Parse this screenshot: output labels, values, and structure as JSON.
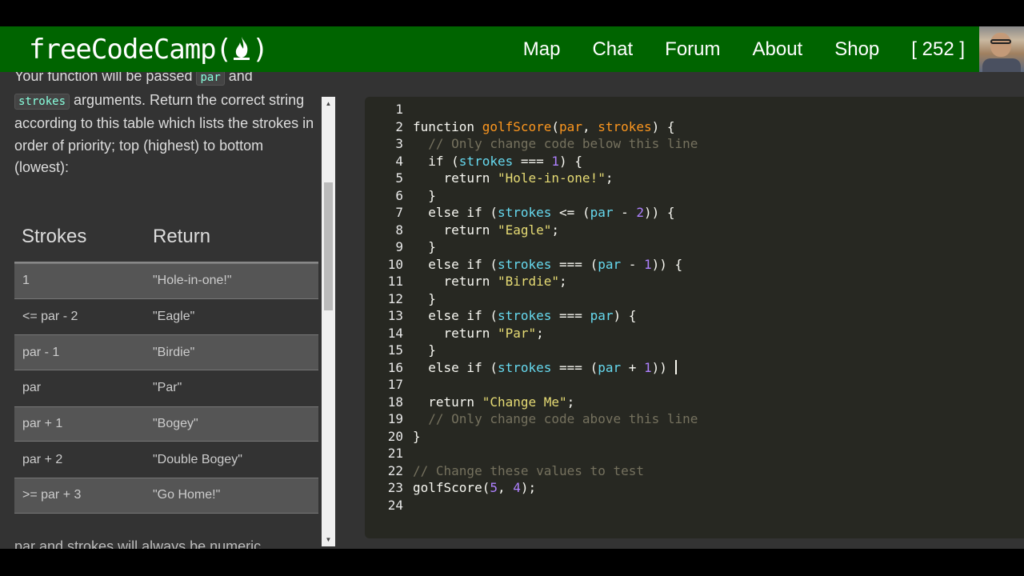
{
  "brand": {
    "text": "freeCodeCamp",
    "open": "(",
    "close": ")"
  },
  "nav": {
    "links": [
      {
        "label": "Map"
      },
      {
        "label": "Chat"
      },
      {
        "label": "Forum"
      },
      {
        "label": "About"
      },
      {
        "label": "Shop"
      },
      {
        "label": "[ 252 ]"
      }
    ]
  },
  "description": {
    "line_a": "Your function will be passed ",
    "chip_par": "par",
    "line_b": " and",
    "chip_strokes": "strokes",
    "line_c": " arguments. Return the correct string according to this table which lists the strokes in order of priority; top (highest) to bottom (lowest):"
  },
  "table": {
    "headers": [
      "Strokes",
      "Return"
    ],
    "rows": [
      [
        "1",
        "\"Hole-in-one!\""
      ],
      [
        "<= par - 2",
        "\"Eagle\""
      ],
      [
        "par - 1",
        "\"Birdie\""
      ],
      [
        "par",
        "\"Par\""
      ],
      [
        "par + 1",
        "\"Bogey\""
      ],
      [
        "par + 2",
        "\"Double Bogey\""
      ],
      [
        ">= par + 3",
        "\"Go Home!\""
      ]
    ]
  },
  "more_text": "par and strokes will always be numeric",
  "editor": {
    "line_numbers": [
      "1",
      "2",
      "3",
      "4",
      "5",
      "6",
      "7",
      "8",
      "9",
      "10",
      "11",
      "12",
      "13",
      "14",
      "15",
      "16",
      "17",
      "18",
      "19",
      "20",
      "21",
      "22",
      "23",
      "24"
    ],
    "tokens": {
      "function": "function",
      "fname": "golfScore",
      "if": "if",
      "else_if": "else if",
      "return": "return",
      "par": "par",
      "strokes": "strokes",
      "c1": "// Only change code below this line",
      "c2": "// Only change code above this line",
      "c3": "// Change these values to test",
      "s1": "\"Hole-in-one!\"",
      "s2": "\"Eagle\"",
      "s3": "\"Birdie\"",
      "s4": "\"Par\"",
      "s5": "\"Change Me\"",
      "n1": "1",
      "n2": "2",
      "n5": "5",
      "n4": "4"
    }
  }
}
